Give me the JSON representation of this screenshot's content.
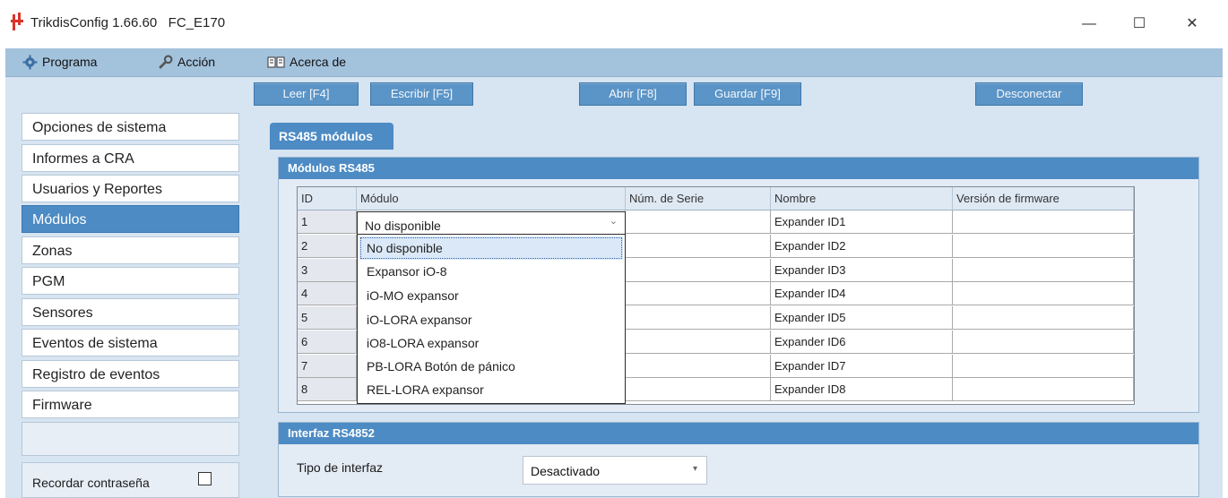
{
  "window": {
    "title": "TrikdisConfig 1.66.60   FC_E170",
    "minimize": "—",
    "maximize": "☐",
    "close": "✕"
  },
  "menu": {
    "items": [
      {
        "label": "Programa",
        "icon": "gear-icon"
      },
      {
        "label": "Acción",
        "icon": "wrench-icon"
      },
      {
        "label": "Acerca de",
        "icon": "book-icon"
      }
    ]
  },
  "toolbar": {
    "read": "Leer [F4]",
    "write": "Escribir [F5]",
    "open": "Abrir [F8]",
    "save": "Guardar [F9]",
    "disconnect": "Desconectar"
  },
  "sidebar": {
    "items": [
      {
        "label": "Opciones de sistema"
      },
      {
        "label": "Informes a CRA"
      },
      {
        "label": "Usuarios y Reportes"
      },
      {
        "label": "Módulos"
      },
      {
        "label": "Zonas"
      },
      {
        "label": "PGM"
      },
      {
        "label": "Sensores"
      },
      {
        "label": "Eventos de sistema"
      },
      {
        "label": "Registro de eventos"
      },
      {
        "label": "Firmware"
      }
    ],
    "active_index": 3,
    "remember_password": "Recordar contraseña"
  },
  "tab": {
    "label": "RS485 módulos"
  },
  "modules_group": {
    "title": "Módulos RS485",
    "columns": [
      "ID",
      "Módulo",
      "Núm. de Serie",
      "Nombre",
      "Versión de firmware"
    ],
    "rows": [
      {
        "id": "1",
        "name": "Expander ID1"
      },
      {
        "id": "2",
        "name": "Expander ID2"
      },
      {
        "id": "3",
        "name": "Expander ID3"
      },
      {
        "id": "4",
        "name": "Expander ID4"
      },
      {
        "id": "5",
        "name": "Expander ID5"
      },
      {
        "id": "6",
        "name": "Expander ID6"
      },
      {
        "id": "7",
        "name": "Expander ID7"
      },
      {
        "id": "8",
        "name": "Expander ID8"
      }
    ],
    "combo_value": "No disponible",
    "dropdown_options": [
      "No disponible",
      "Expansor iO-8",
      "iO-MO expansor",
      "iO-LORA expansor",
      "iO8-LORA expansor",
      "PB-LORA Botón de pánico",
      "REL-LORA expansor"
    ],
    "dropdown_selected_index": 0
  },
  "interface_group": {
    "title": "Interfaz RS4852",
    "label": "Tipo de interfaz",
    "value": "Desactivado"
  },
  "colors": {
    "accent": "#4d8bc4",
    "menubar": "#a3c2dc",
    "background": "#d7e4f1",
    "app_icon": "#d9342b"
  }
}
